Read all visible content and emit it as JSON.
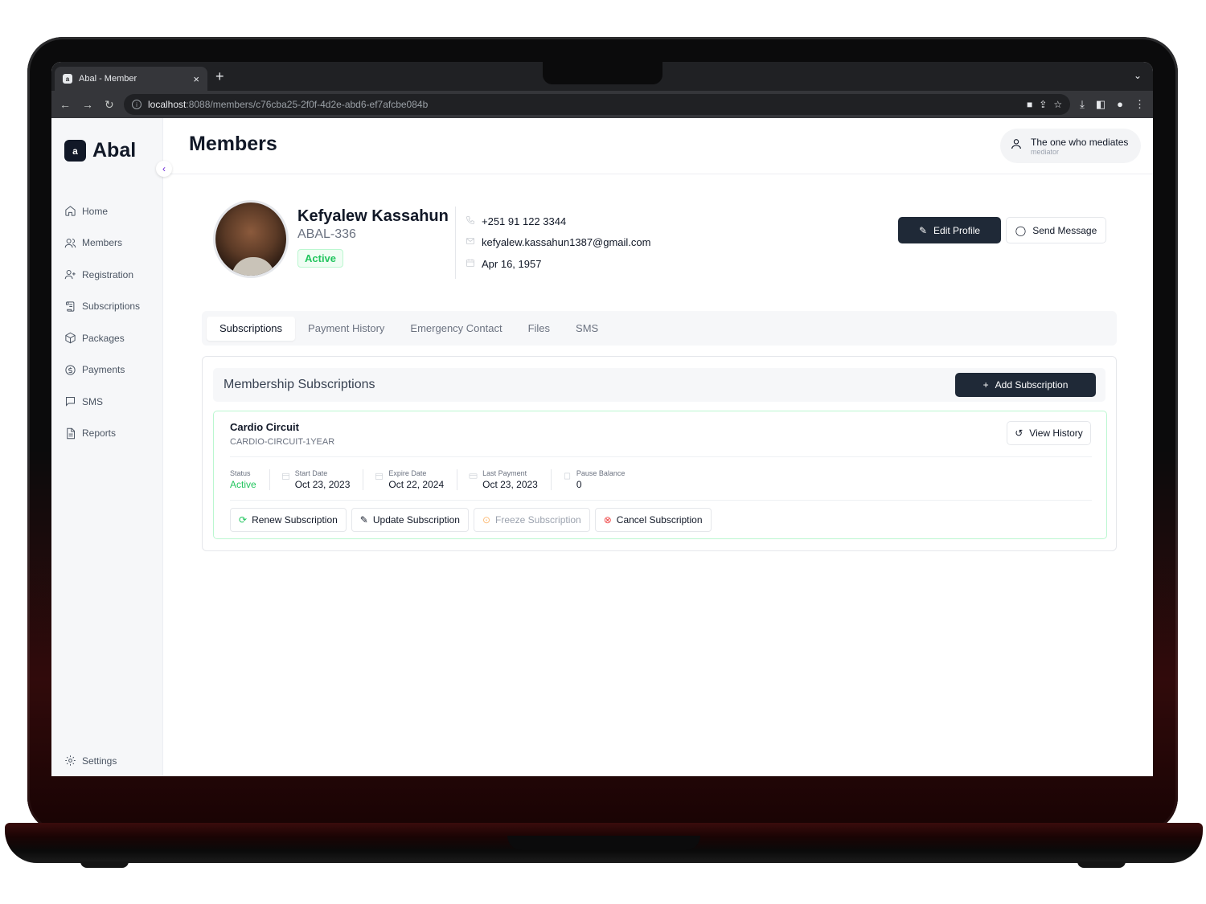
{
  "browser": {
    "tab_title": "Abal - Member",
    "url_host": "localhost",
    "url_path": ":8088/members/c76cba25-2f0f-4d2e-abd6-ef7afcbe084b"
  },
  "sidebar": {
    "brand": "Abal",
    "items": [
      {
        "label": "Home",
        "icon": "home-icon"
      },
      {
        "label": "Members",
        "icon": "users-icon"
      },
      {
        "label": "Registration",
        "icon": "user-plus-icon"
      },
      {
        "label": "Subscriptions",
        "icon": "scroll-icon"
      },
      {
        "label": "Packages",
        "icon": "package-icon"
      },
      {
        "label": "Payments",
        "icon": "coin-icon"
      },
      {
        "label": "SMS",
        "icon": "message-icon"
      },
      {
        "label": "Reports",
        "icon": "file-icon"
      }
    ],
    "settings_label": "Settings"
  },
  "header": {
    "title": "Members",
    "user_name": "The one who mediates",
    "user_role": "mediator"
  },
  "profile": {
    "name": "Kefyalew Kassahun",
    "member_id": "ABAL-336",
    "status": "Active",
    "phone": "+251 91 122 3344",
    "email": "kefyalew.kassahun1387@gmail.com",
    "birth_date": "Apr 16, 1957",
    "edit_label": "Edit Profile",
    "message_label": "Send Message"
  },
  "tabs": [
    {
      "label": "Subscriptions",
      "active": true
    },
    {
      "label": "Payment History",
      "active": false
    },
    {
      "label": "Emergency Contact",
      "active": false
    },
    {
      "label": "Files",
      "active": false
    },
    {
      "label": "SMS",
      "active": false
    }
  ],
  "subscriptions": {
    "section_title": "Membership Subscriptions",
    "add_label": "Add Subscription",
    "item": {
      "name": "Cardio Circuit",
      "code": "CARDIO-CIRCUIT-1YEAR",
      "history_label": "View History",
      "fields": [
        {
          "label": "Status",
          "value": "Active"
        },
        {
          "label": "Start Date",
          "value": "Oct 23, 2023"
        },
        {
          "label": "Expire Date",
          "value": "Oct 22, 2024"
        },
        {
          "label": "Last Payment",
          "value": "Oct 23, 2023"
        },
        {
          "label": "Pause Balance",
          "value": "0"
        }
      ],
      "actions": {
        "renew": "Renew Subscription",
        "update": "Update Subscription",
        "freeze": "Freeze Subscription",
        "cancel": "Cancel Subscription"
      }
    }
  },
  "colors": {
    "accent": "#1f2937",
    "active_green": "#22c55e",
    "cancel_red": "#ef4444",
    "collapse_purple": "#6d28d9"
  }
}
